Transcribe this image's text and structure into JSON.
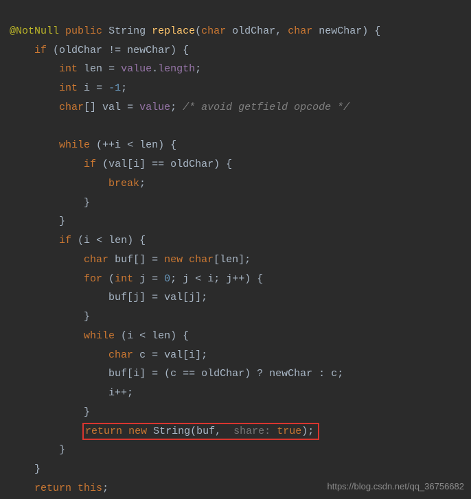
{
  "code": {
    "annotation": "@NotNull",
    "kw_public": "public",
    "type_string": "String",
    "method": "replace",
    "kw_char": "char",
    "param_old": "oldChar",
    "param_new": "newChar",
    "kw_if": "if",
    "kw_int": "int",
    "id_len": "len",
    "field_value": "value",
    "field_length": "length",
    "id_i": "i",
    "num_neg1": "-1",
    "kw_char_arr": "char",
    "id_val": "val",
    "comment1": "/* avoid getfield opcode */",
    "kw_while": "while",
    "kw_break": "break",
    "id_buf": "buf",
    "kw_new": "new",
    "kw_for": "for",
    "id_j": "j",
    "num_0": "0",
    "id_c": "c",
    "kw_return": "return",
    "hint_share": "share:",
    "kw_true": "true",
    "kw_this": "this"
  },
  "watermark": "https://blog.csdn.net/qq_36756682"
}
